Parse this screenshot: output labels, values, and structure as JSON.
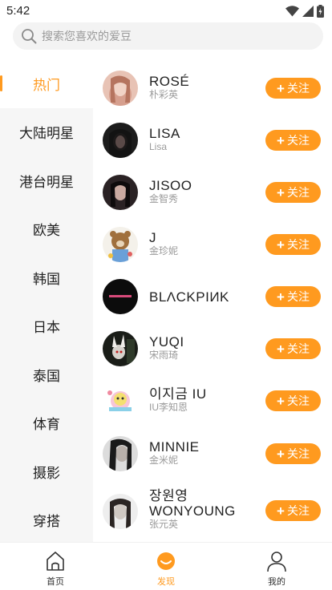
{
  "status_bar": {
    "time": "5:42"
  },
  "search": {
    "placeholder": "搜索您喜欢的爱豆"
  },
  "categories": [
    {
      "label": "热门",
      "active": true
    },
    {
      "label": "大陆明星",
      "active": false
    },
    {
      "label": "港台明星",
      "active": false
    },
    {
      "label": "欧美",
      "active": false
    },
    {
      "label": "韩国",
      "active": false
    },
    {
      "label": "日本",
      "active": false
    },
    {
      "label": "泰国",
      "active": false
    },
    {
      "label": "体育",
      "active": false
    },
    {
      "label": "摄影",
      "active": false
    },
    {
      "label": "穿搭",
      "active": false
    }
  ],
  "follow_label": "关注",
  "idols": [
    {
      "name": "ROSÉ",
      "sub": "朴彩英"
    },
    {
      "name": "LISA",
      "sub": "Lisa"
    },
    {
      "name": "JISOO",
      "sub": "金智秀"
    },
    {
      "name": "J",
      "sub": "金珍妮"
    },
    {
      "name": "BLΛCKPIИK",
      "sub": ""
    },
    {
      "name": "YUQI",
      "sub": "宋雨琦"
    },
    {
      "name": "이지금 IU",
      "sub": "IU李知恩"
    },
    {
      "name": "MINNIE",
      "sub": "金米妮"
    },
    {
      "name_line1": "장원영",
      "name_line2": "WONYOUNG",
      "sub": "张元英"
    }
  ],
  "tabs": [
    {
      "label": "首页",
      "icon": "home-icon",
      "active": false
    },
    {
      "label": "发现",
      "icon": "discover-icon",
      "active": true
    },
    {
      "label": "我的",
      "icon": "profile-icon",
      "active": false
    }
  ],
  "colors": {
    "accent": "#ff9a1f",
    "sidebar_bg": "#f6f6f6",
    "search_bg": "#f3f3f3",
    "muted_text": "#9a9a9a"
  }
}
